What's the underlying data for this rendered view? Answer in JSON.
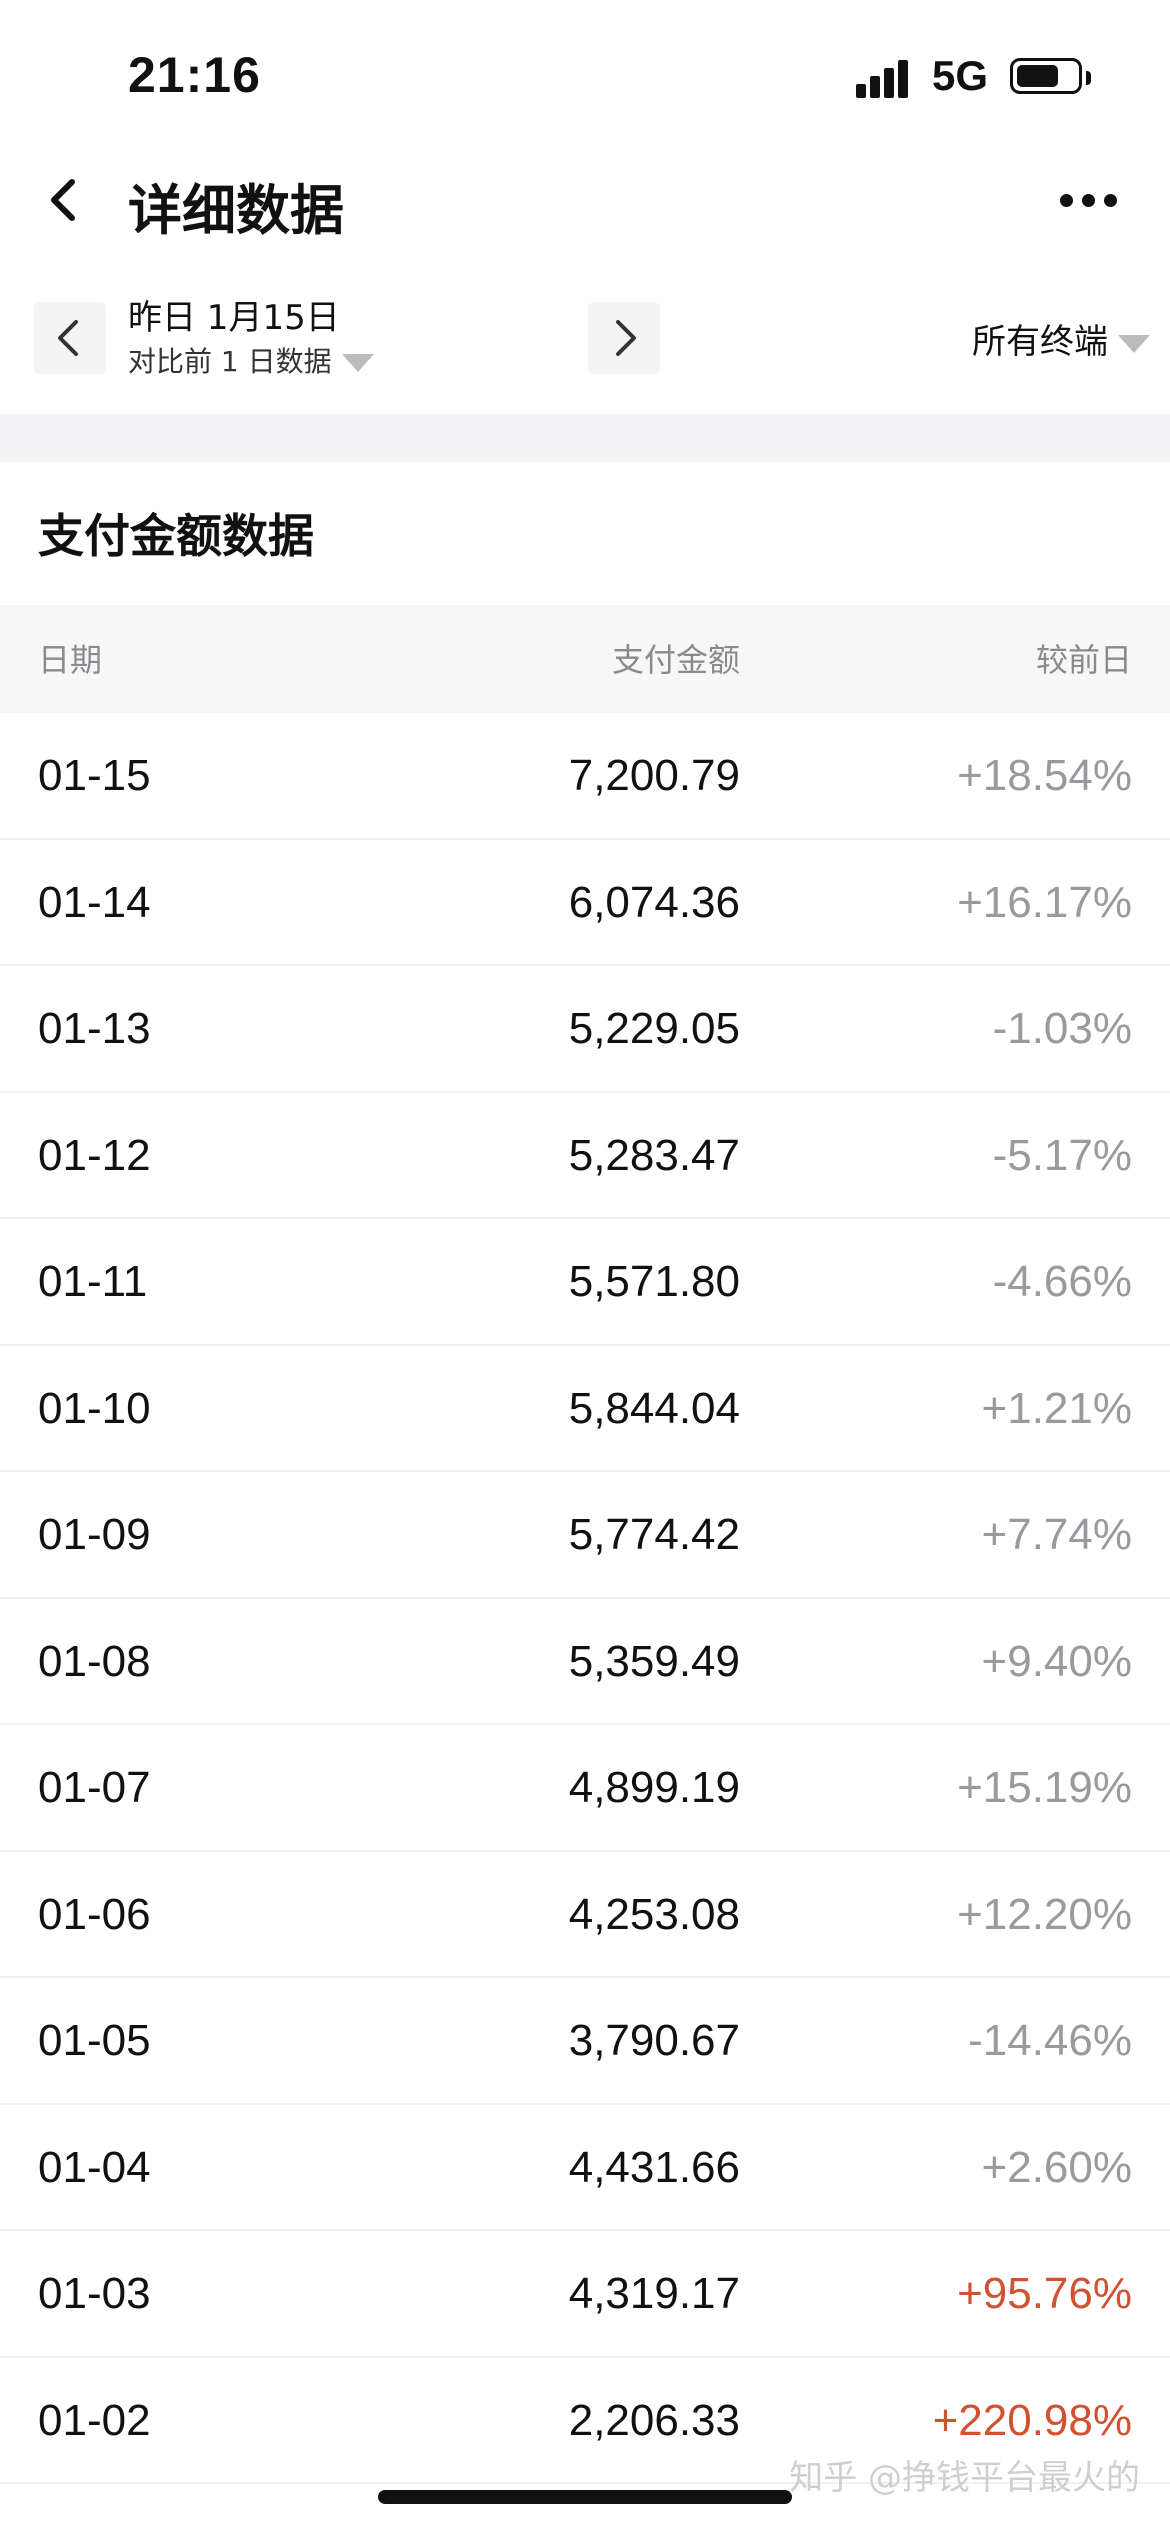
{
  "status_bar": {
    "time": "21:16",
    "network": "5G",
    "battery_level": 0.7
  },
  "nav": {
    "title": "详细数据"
  },
  "date_selector": {
    "date": "昨日 1月15日",
    "compare": "对比前 1 日数据",
    "terminal": "所有终端"
  },
  "section": {
    "title": "支付金额数据"
  },
  "table": {
    "headers": {
      "date": "日期",
      "amount": "支付金额",
      "change": "较前日"
    },
    "rows": [
      {
        "date": "01-15",
        "amount": "7,200.79",
        "change": "+18.54%",
        "highlight": false
      },
      {
        "date": "01-14",
        "amount": "6,074.36",
        "change": "+16.17%",
        "highlight": false
      },
      {
        "date": "01-13",
        "amount": "5,229.05",
        "change": "-1.03%",
        "highlight": false
      },
      {
        "date": "01-12",
        "amount": "5,283.47",
        "change": "-5.17%",
        "highlight": false
      },
      {
        "date": "01-11",
        "amount": "5,571.80",
        "change": "-4.66%",
        "highlight": false
      },
      {
        "date": "01-10",
        "amount": "5,844.04",
        "change": "+1.21%",
        "highlight": false
      },
      {
        "date": "01-09",
        "amount": "5,774.42",
        "change": "+7.74%",
        "highlight": false
      },
      {
        "date": "01-08",
        "amount": "5,359.49",
        "change": "+9.40%",
        "highlight": false
      },
      {
        "date": "01-07",
        "amount": "4,899.19",
        "change": "+15.19%",
        "highlight": false
      },
      {
        "date": "01-06",
        "amount": "4,253.08",
        "change": "+12.20%",
        "highlight": false
      },
      {
        "date": "01-05",
        "amount": "3,790.67",
        "change": "-14.46%",
        "highlight": false
      },
      {
        "date": "01-04",
        "amount": "4,431.66",
        "change": "+2.60%",
        "highlight": false
      },
      {
        "date": "01-03",
        "amount": "4,319.17",
        "change": "+95.76%",
        "highlight": true
      },
      {
        "date": "01-02",
        "amount": "2,206.33",
        "change": "+220.98%",
        "highlight": true
      }
    ]
  },
  "watermark": "知乎 @挣钱平台最火的",
  "colors": {
    "highlight": "#d2522f",
    "muted": "#9a9a9e",
    "band": "#f4f4f6"
  }
}
